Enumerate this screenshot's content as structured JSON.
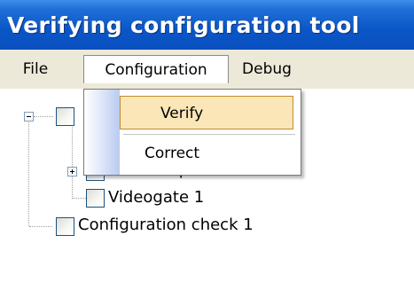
{
  "window": {
    "title": "Verifying configuration tool"
  },
  "menubar": {
    "items": [
      {
        "label": "File"
      },
      {
        "label": "Configuration"
      },
      {
        "label": "Debug"
      }
    ]
  },
  "dropdown": {
    "items": [
      {
        "label": "Verify",
        "highlighted": true
      },
      {
        "label": "Correct",
        "highlighted": false
      }
    ]
  },
  "tree": {
    "nodes": [
      {
        "label": "",
        "depth": 0,
        "expanded": true
      },
      {
        "label": "Video Capture Card 1",
        "depth": 1,
        "expanded": false
      },
      {
        "label": "Videogate 1",
        "depth": 1
      },
      {
        "label": "Configuration check 1",
        "depth": 0
      }
    ]
  },
  "colors": {
    "titlebar": "#0a56c7",
    "menubar": "#ece9d8",
    "highlight": "#fbe6b8",
    "highlight_border": "#c28b2e"
  }
}
